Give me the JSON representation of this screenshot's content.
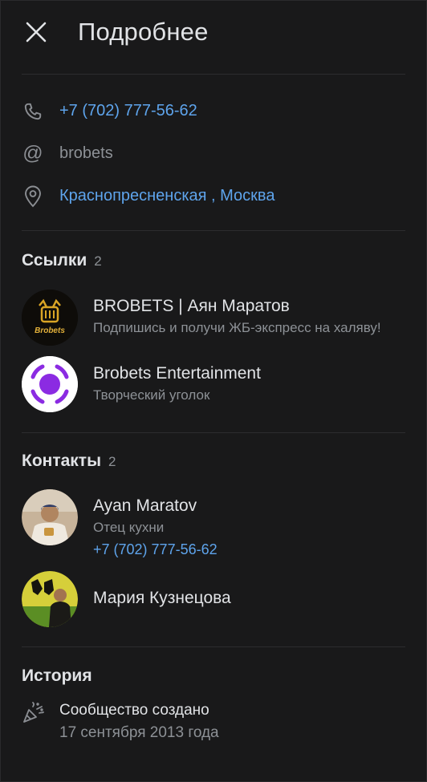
{
  "header": {
    "title": "Подробнее"
  },
  "info": {
    "phone": "+7 (702) 777-56-62",
    "screen_name": "brobets",
    "address": "Краснопресненская , Москва"
  },
  "links": {
    "title": "Ссылки",
    "count": "2",
    "items": [
      {
        "title": "BROBETS | Аян Маратов",
        "subtitle": "Подпишись и получи ЖБ-экспресс на халяву!",
        "avatar_text": "Brobets"
      },
      {
        "title": "Brobets Entertainment",
        "subtitle": "Творческий уголок"
      }
    ]
  },
  "contacts": {
    "title": "Контакты",
    "count": "2",
    "items": [
      {
        "name": "Ayan Maratov",
        "role": "Отец кухни",
        "phone": "+7 (702) 777-56-62"
      },
      {
        "name": "Мария Кузнецова"
      }
    ]
  },
  "history": {
    "title": "История",
    "event": "Сообщество создано",
    "date": "17 сентября 2013 года"
  },
  "colors": {
    "background": "#19191a",
    "accent": "#5ea4ec",
    "text": "#e1e3e6",
    "secondary": "#8d9196"
  },
  "icons": [
    "close-icon",
    "phone-icon",
    "at-icon",
    "location-pin-icon",
    "party-popper-icon"
  ]
}
